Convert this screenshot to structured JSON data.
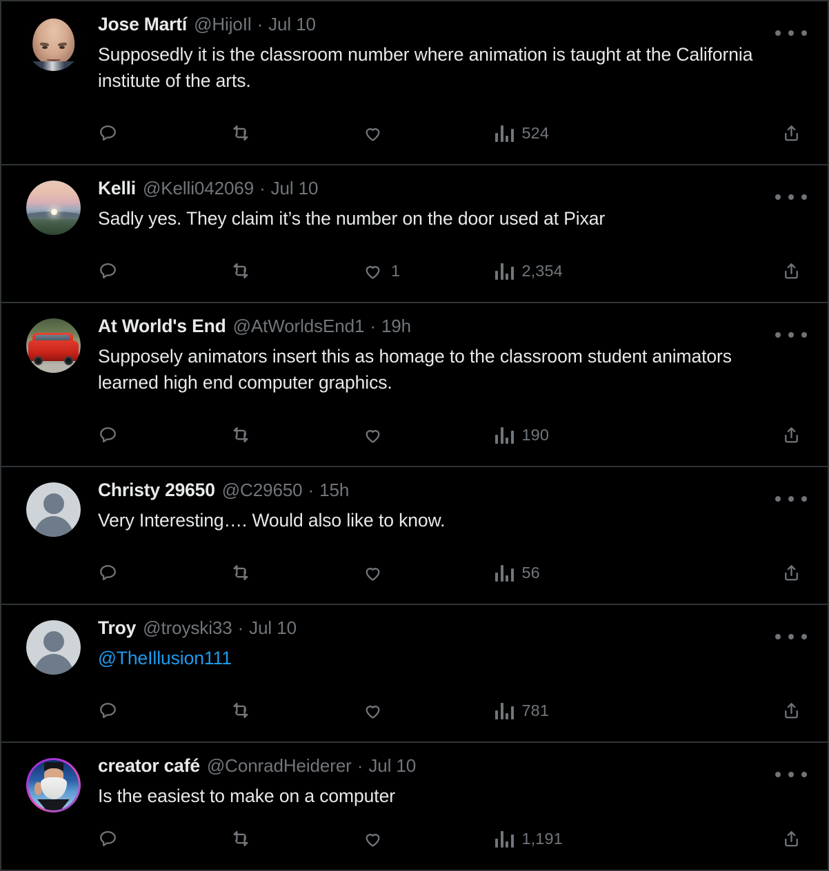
{
  "app": {
    "platform": "X (Twitter)",
    "view": "reply-thread",
    "theme": "dark",
    "link_color": "#1d9bf0",
    "muted_color": "#71767b",
    "text_color": "#e7e9ea"
  },
  "icons": {
    "reply": "reply-icon",
    "retweet": "retweet-icon",
    "like": "heart-icon",
    "views": "views-bar-chart-icon",
    "share": "share-icon",
    "more": "more-options-icon"
  },
  "tweets": [
    {
      "name": "Jose Martí",
      "handle": "@HijoIl",
      "dot": "·",
      "time": "Jul 10",
      "text": "Supposedly it is the classroom number where animation is taught at the California institute of the arts.",
      "is_mention_link": false,
      "avatar": "photo-elderly-man",
      "reply_count": "",
      "retweet_count": "",
      "like_count": "",
      "views_count": "524"
    },
    {
      "name": "Kelli",
      "handle": "@Kelli042069",
      "dot": "·",
      "time": "Jul 10",
      "text": "Sadly yes. They claim it’s the number on the door used at Pixar",
      "is_mention_link": false,
      "avatar": "photo-sunset-landscape",
      "reply_count": "",
      "retweet_count": "",
      "like_count": "1",
      "views_count": "2,354"
    },
    {
      "name": "At World's End",
      "handle": "@AtWorldsEnd1",
      "dot": "·",
      "time": "19h",
      "text": "Supposely animators insert this as homage to the classroom student animators learned high end computer graphics.",
      "is_mention_link": false,
      "avatar": "photo-red-wagon",
      "reply_count": "",
      "retweet_count": "",
      "like_count": "",
      "views_count": "190"
    },
    {
      "name": "Christy 29650",
      "handle": "@C29650",
      "dot": "·",
      "time": "15h",
      "text": "Very Interesting…. Would also like to know.",
      "is_mention_link": false,
      "avatar": "default-person",
      "reply_count": "",
      "retweet_count": "",
      "like_count": "",
      "views_count": "56"
    },
    {
      "name": "Troy",
      "handle": "@troyski33",
      "dot": "·",
      "time": "Jul 10",
      "text": "@TheIllusion111",
      "is_mention_link": true,
      "avatar": "default-person",
      "reply_count": "",
      "retweet_count": "",
      "like_count": "",
      "views_count": "781"
    },
    {
      "name": "creator café",
      "handle": "@ConradHeiderer",
      "dot": "·",
      "time": "Jul 10",
      "text": "Is the easiest to make on a computer",
      "is_mention_link": false,
      "avatar": "photo-bearded-creator-ring",
      "reply_count": "",
      "retweet_count": "",
      "like_count": "",
      "views_count": "1,191"
    }
  ]
}
